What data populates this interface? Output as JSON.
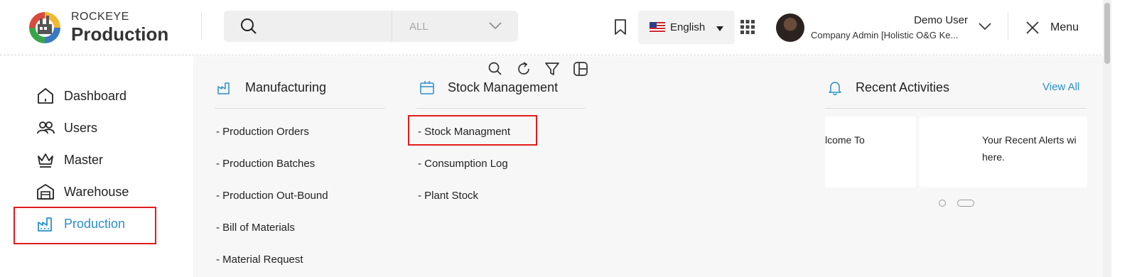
{
  "header": {
    "brand_top": "ROCKEYE",
    "brand_main": "Production",
    "search": {
      "placeholder": "",
      "scope": "ALL"
    },
    "language": "English",
    "user": {
      "name": "Demo User",
      "role": "Company Admin [Holistic O&G Ke..."
    },
    "menu_label": "Menu",
    "icons": [
      "search-icon",
      "chevron-down-icon",
      "bookmark-icon",
      "us-flag-icon",
      "apps-grid-icon",
      "close-icon"
    ]
  },
  "sidebar": {
    "items": [
      {
        "label": "Dashboard",
        "icon": "home-icon"
      },
      {
        "label": "Users",
        "icon": "users-icon"
      },
      {
        "label": "Master",
        "icon": "crown-icon"
      },
      {
        "label": "Warehouse",
        "icon": "warehouse-icon"
      },
      {
        "label": "Production",
        "icon": "factory-icon",
        "active": true
      }
    ]
  },
  "main": {
    "toolbar_icons": [
      "search-icon",
      "refresh-icon",
      "filter-icon",
      "layout-icon"
    ],
    "manufacturing": {
      "title": "Manufacturing",
      "links": [
        "- Production Orders",
        "- Production Batches",
        "- Production Out-Bound",
        "- Bill of Materials",
        "- Material Request"
      ]
    },
    "stock": {
      "title": "Stock Management",
      "links": [
        "- Stock Managment",
        "- Consumption Log",
        "- Plant Stock"
      ]
    },
    "recent": {
      "title": "Recent Activities",
      "view_all": "View All",
      "card1_text": "lcome To",
      "card2_line1": "Your Recent Alerts wi",
      "card2_line2": "here."
    }
  },
  "colors": {
    "accent": "#2a8fc8",
    "highlight": "#e01d1d"
  }
}
